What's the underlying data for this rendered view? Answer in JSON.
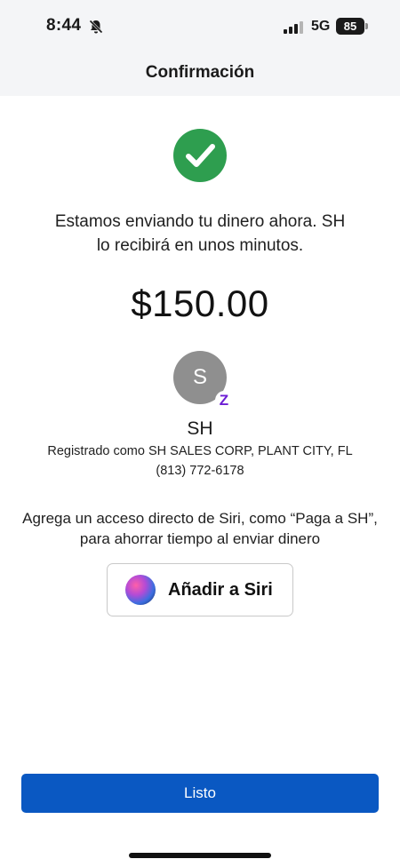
{
  "status_bar": {
    "time": "8:44",
    "network": "5G",
    "battery": "85",
    "icons": [
      "bell-muted-icon",
      "signal-bars-icon",
      "battery-icon"
    ]
  },
  "header": {
    "title": "Confirmación"
  },
  "confirmation": {
    "icon": "checkmark-icon",
    "icon_color": "#2e9e4f",
    "message_line1": "Estamos enviando tu dinero ahora. SH",
    "message_line2": "lo recibirá en unos minutos.",
    "amount": "$150.00"
  },
  "recipient": {
    "initial": "S",
    "badge": "Z",
    "badge_icon": "zelle-icon",
    "badge_color": "#6d1ed4",
    "name": "SH",
    "registered_as": "Registrado como SH SALES CORP, PLANT CITY, FL",
    "phone": "(813) 772-6178"
  },
  "siri": {
    "text_line1": "Agrega un acceso directo de Siri, como “Paga a SH”,",
    "text_line2": "para ahorrar tiempo al enviar dinero",
    "button_label": "Añadir a Siri",
    "icon": "siri-icon"
  },
  "footer": {
    "done_label": "Listo",
    "accent": "#0a58c2"
  }
}
